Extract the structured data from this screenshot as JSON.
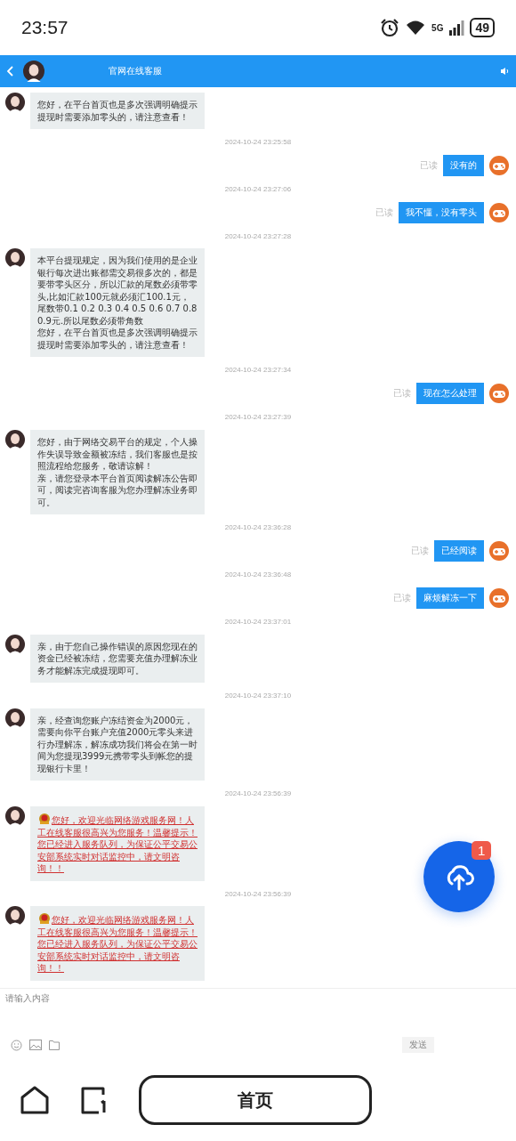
{
  "status_bar": {
    "time": "23:57",
    "network": "5G",
    "battery": "49"
  },
  "header": {
    "title": "官网在线客服"
  },
  "messages": [
    {
      "kind": "agent",
      "text": "您好，在平台首页也是多次强调明确提示提现时需要添加零头的，请注意查看！"
    },
    {
      "kind": "time",
      "text": "2024-10-24 23:25:58"
    },
    {
      "kind": "user",
      "text": "没有的",
      "status": "已读"
    },
    {
      "kind": "time",
      "text": "2024-10-24 23:27:06"
    },
    {
      "kind": "user",
      "text": "我不懂，没有零头",
      "status": "已读"
    },
    {
      "kind": "time",
      "text": "2024-10-24 23:27:28"
    },
    {
      "kind": "agent",
      "text": "本平台提现规定，因为我们使用的是企业银行每次进出账都需交易很多次的，都是要带零头区分，所以汇款的尾数必须带零头,比如汇款100元就必须汇100.1元，尾数带0.1 0.2 0.3 0.4 0.5 0.6 0.7 0.8 0.9元.所以尾数必须带角数",
      "text_2": "您好，在平台首页也是多次强调明确提示提现时需要添加零头的，请注意查看！"
    },
    {
      "kind": "time",
      "text": "2024-10-24 23:27:34"
    },
    {
      "kind": "user",
      "text": "现在怎么处理",
      "status": "已读"
    },
    {
      "kind": "time",
      "text": "2024-10-24 23:27:39"
    },
    {
      "kind": "agent",
      "text": "您好，由于网络交易平台的规定，个人操作失误导致金额被冻结，我们客服也是按照流程给您服务，敬请谅解！",
      "text_2": "亲，请您登录本平台首页阅读解冻公告即可，阅读完咨询客服为您办理解冻业务即可。"
    },
    {
      "kind": "time",
      "text": "2024-10-24 23:36:28"
    },
    {
      "kind": "user",
      "text": "已经阅读",
      "status": "已读"
    },
    {
      "kind": "time",
      "text": "2024-10-24 23:36:48"
    },
    {
      "kind": "user",
      "text": "麻烦解冻一下",
      "status": "已读"
    },
    {
      "kind": "time",
      "text": "2024-10-24 23:37:01"
    },
    {
      "kind": "agent",
      "text": "亲，由于您自己操作错误的原因您现在的资金已经被冻结，您需要充值办理解冻业务才能解冻完成提现即可。"
    },
    {
      "kind": "time",
      "text": "2024-10-24 23:37:10"
    },
    {
      "kind": "agent",
      "text": "亲，经查询您账户冻结资金为2000元，需要向你平台账户充值2000元零头来进行办理解冻，解冻成功我们将会在第一时间为您提现3999元携带零头到帐您的提现银行卡里！"
    },
    {
      "kind": "time",
      "text": "2024-10-24 23:56:39"
    },
    {
      "kind": "notice",
      "text": "您好，欢迎光临网络游戏服务网！人工在线客服很高兴为您服务！温馨提示！您已经进入服务队列，为保证公平交易公安部系统实时对话监控中，请文明咨询！！"
    },
    {
      "kind": "time",
      "text": "2024-10-24 23:56:39"
    },
    {
      "kind": "notice",
      "text": "您好，欢迎光临网络游戏服务网！人工在线客服很高兴为您服务！温馨提示！您已经进入服务队列，为保证公平交易公安部系统实时对话监控中，请文明咨询！！"
    }
  ],
  "upload_button": {
    "badge": "1"
  },
  "composer": {
    "placeholder": "请输入内容",
    "send": "发送"
  },
  "nav": {
    "home_label": "首页"
  }
}
